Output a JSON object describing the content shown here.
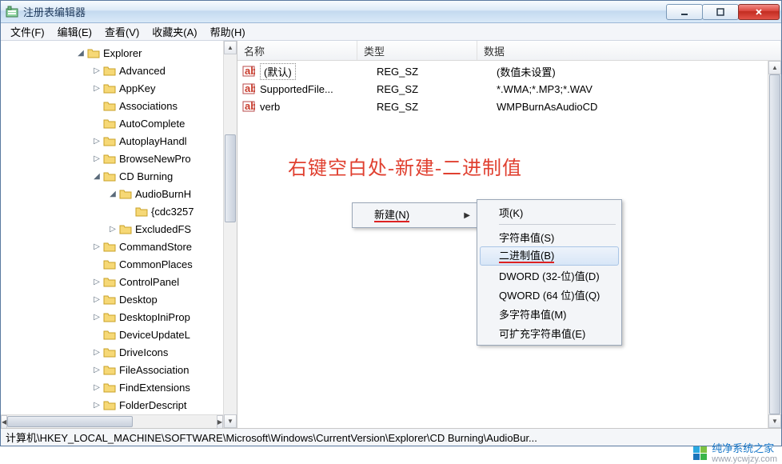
{
  "window": {
    "title": "注册表编辑器"
  },
  "menu": {
    "file": "文件(F)",
    "edit": "编辑(E)",
    "view": "查看(V)",
    "fav": "收藏夹(A)",
    "help": "帮助(H)"
  },
  "tree": {
    "n0": "Explorer",
    "n1": "Advanced",
    "n2": "AppKey",
    "n3": "Associations",
    "n4": "AutoComplete",
    "n5": "AutoplayHandl",
    "n6": "BrowseNewPro",
    "n7": "CD Burning",
    "n8": "AudioBurnH",
    "n9": "{cdc3257",
    "n10": "ExcludedFS",
    "n11": "CommandStore",
    "n12": "CommonPlaces",
    "n13": "ControlPanel",
    "n14": "Desktop",
    "n15": "DesktopIniProp",
    "n16": "DeviceUpdateL",
    "n17": "DriveIcons",
    "n18": "FileAssociation",
    "n19": "FindExtensions",
    "n20": "FolderDescript"
  },
  "list": {
    "hdr_name": "名称",
    "hdr_type": "类型",
    "hdr_data": "数据",
    "r0_name": "(默认)",
    "r0_type": "REG_SZ",
    "r0_data": "(数值未设置)",
    "r1_name": "SupportedFile...",
    "r1_type": "REG_SZ",
    "r1_data": "*.WMA;*.MP3;*.WAV",
    "r2_name": "verb",
    "r2_type": "REG_SZ",
    "r2_data": "WMPBurnAsAudioCD"
  },
  "annotation": "右键空白处-新建-二进制值",
  "ctx": {
    "new": "新建(N)"
  },
  "sub": {
    "key": "项(K)",
    "string": "字符串值(S)",
    "binary": "二进制值(B)",
    "dword": "DWORD (32-位)值(D)",
    "qword": "QWORD (64 位)值(Q)",
    "multi": "多字符串值(M)",
    "expand": "可扩充字符串值(E)"
  },
  "status": "计算机\\HKEY_LOCAL_MACHINE\\SOFTWARE\\Microsoft\\Windows\\CurrentVersion\\Explorer\\CD Burning\\AudioBur...",
  "wm": {
    "name": "纯净系统之家",
    "url": "www.ycwjzy.com"
  }
}
